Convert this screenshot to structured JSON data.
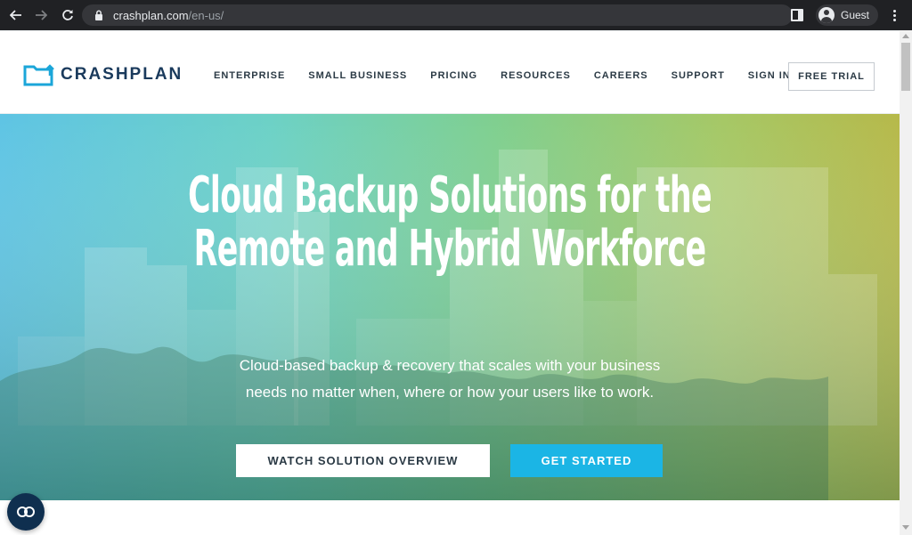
{
  "browser": {
    "url_host": "crashplan.com",
    "url_path": "/en-us/",
    "profile_label": "Guest"
  },
  "header": {
    "logo_text": "CRASHPLAN",
    "nav": [
      {
        "label": "ENTERPRISE"
      },
      {
        "label": "SMALL BUSINESS"
      },
      {
        "label": "PRICING"
      },
      {
        "label": "RESOURCES"
      },
      {
        "label": "CAREERS"
      },
      {
        "label": "SUPPORT"
      },
      {
        "label": "SIGN IN"
      }
    ],
    "cta_label": "FREE TRIAL"
  },
  "hero": {
    "title_line1": "Cloud Backup Solutions for the",
    "title_line2": "Remote and Hybrid Workforce",
    "sub_line1": "Cloud-based backup & recovery that scales with your business",
    "sub_line2": "needs no matter when, where or how your users like to work.",
    "watch_label": "WATCH SOLUTION OVERVIEW",
    "start_label": "GET STARTED"
  },
  "colors": {
    "brand_dark": "#1a3a5c",
    "accent_blue": "#1bb5e5",
    "logo_blue": "#1ba6d9"
  },
  "icons": {
    "back": "arrow-left-icon",
    "forward": "arrow-right-icon",
    "reload": "reload-icon",
    "lock": "lock-icon",
    "side_panel": "side-panel-icon",
    "menu": "kebab-menu-icon",
    "logo": "folder-upload-icon",
    "widget": "accessibility-widget-icon"
  }
}
